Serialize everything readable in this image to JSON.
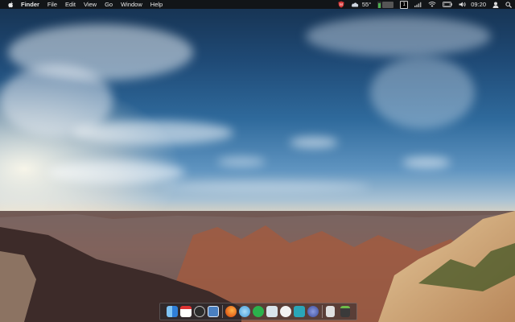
{
  "menubar": {
    "apple_icon": "apple-icon",
    "app_name": "Finder",
    "menus": [
      "File",
      "Edit",
      "View",
      "Go",
      "Window",
      "Help"
    ],
    "status": {
      "temperature": "55°",
      "desktop_number": "1",
      "time": "09:20"
    }
  },
  "dock": {
    "apps": [
      {
        "name": "finder-icon",
        "color": "#3a8de0"
      },
      {
        "name": "calendar-icon",
        "color": "#ffffff"
      },
      {
        "name": "clock-icon",
        "color": "#2b2b2b"
      },
      {
        "name": "preview-icon",
        "color": "#4a7fc0"
      },
      {
        "name": "firefox-icon",
        "color": "#e66a1f"
      },
      {
        "name": "itunes-icon",
        "color": "#5ab4e8"
      },
      {
        "name": "spotify-icon",
        "color": "#2bb24c"
      },
      {
        "name": "mail-icon",
        "color": "#d8e3ea"
      },
      {
        "name": "messages-icon",
        "color": "#f2f2f2"
      },
      {
        "name": "vpn-shield-icon",
        "color": "#2aa6b8"
      },
      {
        "name": "pen-icon",
        "color": "#5a6cb8"
      },
      {
        "name": "document-icon",
        "color": "#e0e0e0"
      },
      {
        "name": "trash-icon",
        "color": "#3a3a3a"
      }
    ]
  }
}
